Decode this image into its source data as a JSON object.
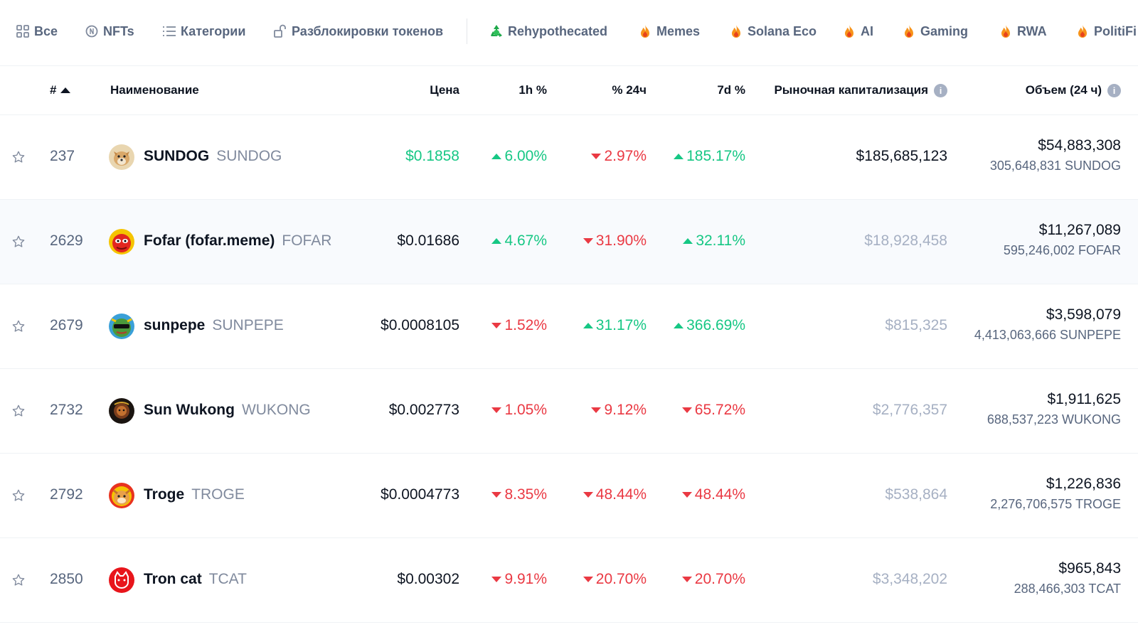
{
  "tabs": [
    {
      "label": "Все",
      "icon": "grid-icon"
    },
    {
      "label": "NFTs",
      "icon": "nft-icon"
    },
    {
      "label": "Категории",
      "icon": "list-icon"
    },
    {
      "label": "Разблокировки токенов",
      "icon": "unlock-icon"
    },
    {
      "label": "Rehypothecated",
      "icon": "recycle-icon"
    },
    {
      "label": "Memes",
      "icon": "fire-icon"
    },
    {
      "label": "Solana Eco",
      "icon": "fire-icon"
    },
    {
      "label": "AI",
      "icon": "fire-icon"
    },
    {
      "label": "Gaming",
      "icon": "fire-icon"
    },
    {
      "label": "RWA",
      "icon": "fire-icon"
    },
    {
      "label": "PolitiFi",
      "icon": "fire-icon"
    }
  ],
  "table": {
    "headers": {
      "rank": "#",
      "name": "Наименование",
      "price": "Цена",
      "h1": "1h %",
      "h24": "% 24ч",
      "d7": "7d %",
      "mcap": "Рыночная капитализация",
      "volume": "Объем (24 ч)"
    },
    "rows": [
      {
        "rank": "237",
        "name": "SUNDOG",
        "symbol": "SUNDOG",
        "price": "$0.1858",
        "h1": "6.00%",
        "h24": "2.97%",
        "d7": "185.17%",
        "mcap": "$185,685,123",
        "volume": "$54,883,308",
        "volume_tokens": "305,648,831 SUNDOG"
      },
      {
        "rank": "2629",
        "name": "Fofar (fofar.meme)",
        "symbol": "FOFAR",
        "price": "$0.01686",
        "h1": "4.67%",
        "h24": "31.90%",
        "d7": "32.11%",
        "mcap": "$18,928,458",
        "volume": "$11,267,089",
        "volume_tokens": "595,246,002 FOFAR"
      },
      {
        "rank": "2679",
        "name": "sunpepe",
        "symbol": "SUNPEPE",
        "price": "$0.0008105",
        "h1": "1.52%",
        "h24": "31.17%",
        "d7": "366.69%",
        "mcap": "$815,325",
        "volume": "$3,598,079",
        "volume_tokens": "4,413,063,666 SUNPEPE"
      },
      {
        "rank": "2732",
        "name": "Sun Wukong",
        "symbol": "WUKONG",
        "price": "$0.002773",
        "h1": "1.05%",
        "h24": "9.12%",
        "d7": "65.72%",
        "mcap": "$2,776,357",
        "volume": "$1,911,625",
        "volume_tokens": "688,537,223 WUKONG"
      },
      {
        "rank": "2792",
        "name": "Troge",
        "symbol": "TROGE",
        "price": "$0.0004773",
        "h1": "8.35%",
        "h24": "48.44%",
        "d7": "48.44%",
        "mcap": "$538,864",
        "volume": "$1,226,836",
        "volume_tokens": "2,276,706,575 TROGE"
      },
      {
        "rank": "2850",
        "name": "Tron cat",
        "symbol": "TCAT",
        "price": "$0.00302",
        "h1": "9.91%",
        "h24": "20.70%",
        "d7": "20.70%",
        "mcap": "$3,348,202",
        "volume": "$965,843",
        "volume_tokens": "288,466,303 TCAT"
      }
    ]
  },
  "colors": {
    "up": "#16c784",
    "down": "#ea3943",
    "text": "#0d1421",
    "muted": "#58667e",
    "dim": "#a6b0c3"
  }
}
